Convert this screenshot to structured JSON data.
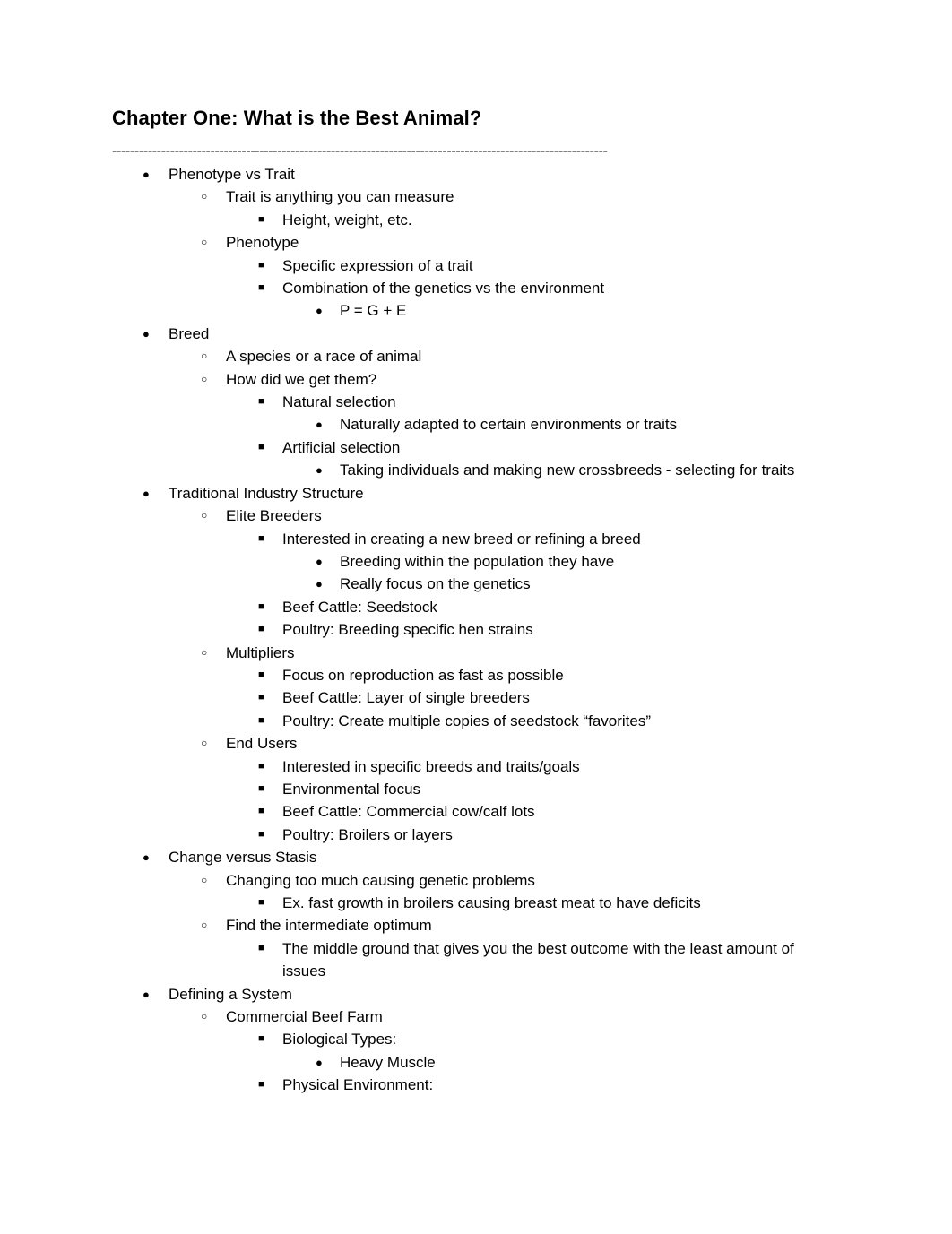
{
  "document": {
    "title": "Chapter One: What is the Best Animal?",
    "divider": "---------------------------------------------------------------------------------------------------------------",
    "bullets": {
      "level1": "●",
      "level2": "○",
      "level3": "■",
      "level4": "●"
    },
    "outline": [
      {
        "text": "Phenotype vs Trait",
        "children": [
          {
            "text": "Trait is anything you can measure",
            "children": [
              {
                "text": "Height, weight, etc.",
                "children": []
              }
            ]
          },
          {
            "text": "Phenotype",
            "children": [
              {
                "text": "Specific expression of a trait",
                "children": []
              },
              {
                "text": "Combination of the genetics vs the environment",
                "children": [
                  {
                    "text": "P = G + E",
                    "children": []
                  }
                ]
              }
            ]
          }
        ]
      },
      {
        "text": "Breed",
        "children": [
          {
            "text": "A species or a race of animal",
            "children": []
          },
          {
            "text": "How did we get them?",
            "children": [
              {
                "text": "Natural selection",
                "children": [
                  {
                    "text": "Naturally adapted to certain environments or traits",
                    "children": []
                  }
                ]
              },
              {
                "text": "Artificial selection",
                "children": [
                  {
                    "text": "Taking individuals and making new crossbreeds - selecting for traits",
                    "children": []
                  }
                ]
              }
            ]
          }
        ]
      },
      {
        "text": "Traditional Industry Structure",
        "children": [
          {
            "text": "Elite Breeders",
            "children": [
              {
                "text": "Interested in creating a new breed or refining a breed",
                "children": [
                  {
                    "text": "Breeding within the population they have",
                    "children": []
                  },
                  {
                    "text": "Really focus on the genetics",
                    "children": []
                  }
                ]
              },
              {
                "text": "Beef Cattle: Seedstock",
                "children": []
              },
              {
                "text": "Poultry: Breeding specific hen strains",
                "children": []
              }
            ]
          },
          {
            "text": "Multipliers",
            "children": [
              {
                "text": "Focus on reproduction as fast as possible",
                "children": []
              },
              {
                "text": "Beef Cattle: Layer of single breeders",
                "children": []
              },
              {
                "text": "Poultry: Create multiple copies of seedstock “favorites”",
                "children": []
              }
            ]
          },
          {
            "text": "End Users",
            "children": [
              {
                "text": "Interested in specific breeds and traits/goals",
                "children": []
              },
              {
                "text": "Environmental focus",
                "children": []
              },
              {
                "text": "Beef Cattle: Commercial cow/calf lots",
                "children": []
              },
              {
                "text": "Poultry: Broilers or layers",
                "children": []
              }
            ]
          }
        ]
      },
      {
        "text": "Change versus Stasis",
        "children": [
          {
            "text": "Changing too much causing genetic problems",
            "children": [
              {
                "text": "Ex. fast growth in broilers causing breast meat to have deficits",
                "children": []
              }
            ]
          },
          {
            "text": "Find the intermediate optimum",
            "children": [
              {
                "text": "The middle ground that gives you the best outcome with the least amount of issues",
                "children": []
              }
            ]
          }
        ]
      },
      {
        "text": "Defining a System",
        "children": [
          {
            "text": "Commercial Beef Farm",
            "children": [
              {
                "text": "Biological Types:",
                "children": [
                  {
                    "text": "Heavy Muscle",
                    "children": []
                  }
                ]
              },
              {
                "text": "Physical Environment:",
                "children": []
              }
            ]
          }
        ]
      }
    ]
  }
}
